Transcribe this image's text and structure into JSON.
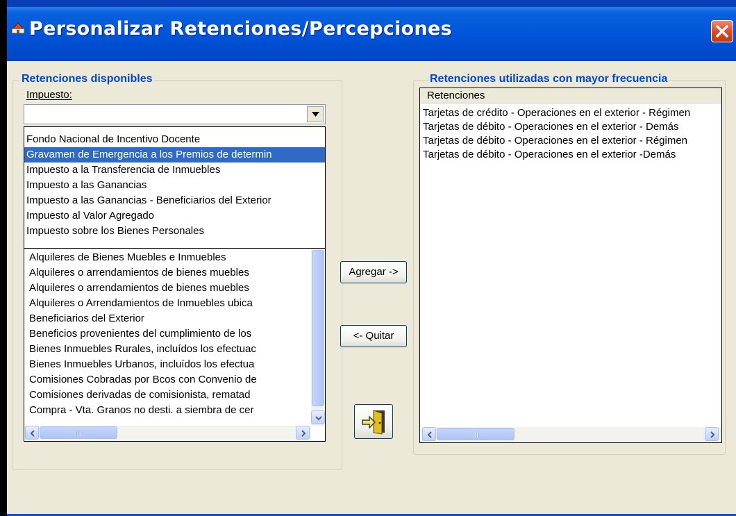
{
  "window": {
    "title": "Personalizar Retenciones/Percepciones",
    "close_symbol": "✕"
  },
  "left_group": {
    "title": "Retenciones disponibles",
    "impuesto_label": "Impuesto:",
    "impuesto_value": "",
    "dropdown_options": [
      "Fondo Nacional de Incentivo Docente",
      "Gravamen de Emergencia a los Premios de determin",
      "Impuesto a la Transferencia de Inmuebles",
      "Impuesto a las Ganancias",
      "Impuesto a las Ganancias - Beneficiarios del Exterior",
      "Impuesto al Valor Agregado",
      "Impuesto sobre los Bienes Personales"
    ],
    "dropdown_selected_index": 1,
    "list_items": [
      "Alquileres de Bienes Muebles e Inmuebles",
      "Alquileres o arrendamientos de bienes muebles",
      "Alquileres o arrendamientos de bienes muebles",
      "Alquileres o Arrendamientos de Inmuebles ubica",
      "Beneficiarios del Exterior",
      "Beneficios provenientes del cumplimiento de los",
      "Bienes Inmuebles Rurales, incluídos los efectuac",
      "Bienes Inmuebles Urbanos, incluídos los efectua",
      "Comisiones Cobradas por Bcos con Convenio de",
      "Comisiones derivadas de comisionista, rematad",
      "Compra - Vta. Granos no desti. a siembra de cer"
    ]
  },
  "buttons": {
    "add": "Agregar ->",
    "remove": "<- Quitar",
    "exit_icon": "exit-door-icon"
  },
  "right_group": {
    "title": "Retenciones utilizadas con mayor frecuencia",
    "column_header": "Retenciones",
    "items": [
      "Tarjetas de crédito - Operaciones en el exterior - Régimen",
      "Tarjetas de débito - Operaciones en el exterior - Demás",
      "Tarjetas de débito - Operaciones en el exterior - Régimen",
      "Tarjetas de débito - Operaciones en el exterior -Demás"
    ]
  },
  "scrollbar_grip": "III",
  "colors": {
    "title_bar": "#0053d8",
    "close_button": "#dd4b27",
    "group_label": "#0046d5",
    "selection": "#316ac5",
    "window_bg": "#ece9d8"
  }
}
